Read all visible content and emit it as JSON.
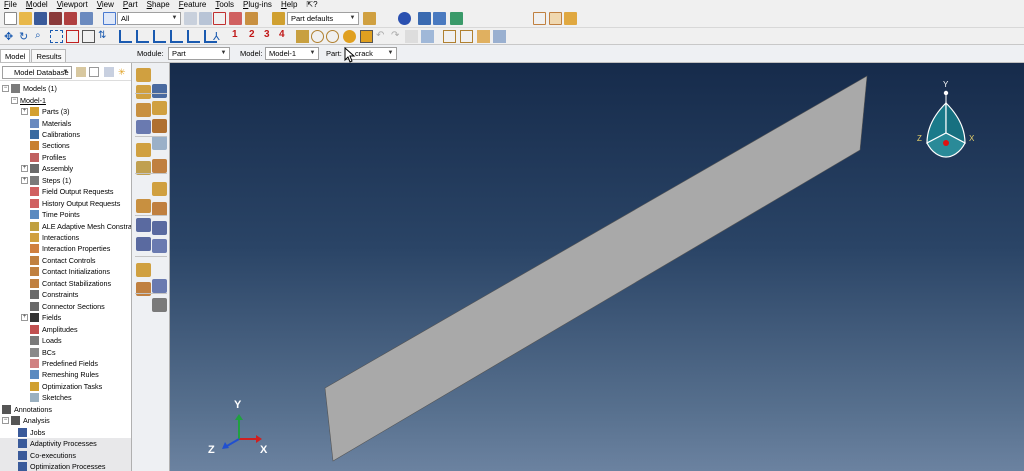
{
  "menu": {
    "items": [
      "File",
      "Model",
      "Viewport",
      "View",
      "Part",
      "Shape",
      "Feature",
      "Tools",
      "Plug-ins",
      "Help"
    ]
  },
  "toolbar": {
    "selection_filter": "All",
    "render_style": "Part defaults",
    "numbers": [
      "1",
      "2",
      "3",
      "4"
    ]
  },
  "context": {
    "module_label": "Module:",
    "module_value": "Part",
    "model_label": "Model:",
    "model_value": "Model-1",
    "part_label": "Part:",
    "part_value": "crack"
  },
  "tabs": [
    "Model",
    "Results"
  ],
  "tree": {
    "dropdown": "Model Database",
    "root": "Models (1)",
    "model": "Model-1",
    "items": [
      "Parts (3)",
      "Materials",
      "Calibrations",
      "Sections",
      "Profiles",
      "Assembly",
      "Steps (1)",
      "Field Output Requests",
      "History Output Requests",
      "Time Points",
      "ALE Adaptive Mesh Constra",
      "Interactions",
      "Interaction Properties",
      "Contact Controls",
      "Contact Initializations",
      "Contact Stabilizations",
      "Constraints",
      "Connector Sections",
      "Fields",
      "Amplitudes",
      "Loads",
      "BCs",
      "Predefined Fields",
      "Remeshing Rules",
      "Optimization Tasks",
      "Sketches"
    ],
    "annotations": "Annotations",
    "analysis": "Analysis",
    "analysis_items": [
      "Jobs",
      "Adaptivity Processes",
      "Co-executions",
      "Optimization Processes"
    ]
  },
  "triad": {
    "x": "X",
    "y": "Y",
    "z": "Z"
  },
  "view_cube": {
    "x": "X",
    "y": "Y",
    "z": "Z"
  },
  "colors": {
    "viewport_top": "#162b4b",
    "viewport_bottom": "#6b82a0",
    "part_fill": "#a9a9a9",
    "axis_x": "#d02020",
    "axis_y": "#20a040",
    "axis_z": "#2050d0",
    "cube_teal": "#1a7a8a"
  }
}
